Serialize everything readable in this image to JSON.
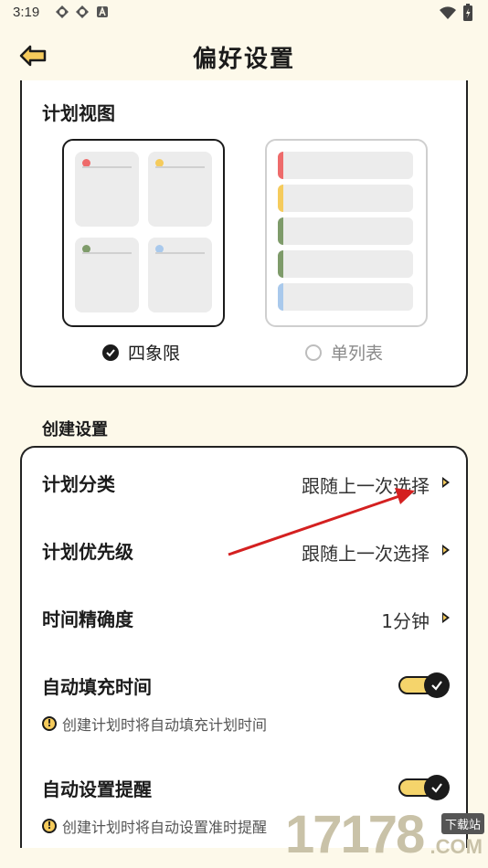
{
  "status": {
    "time": "3:19"
  },
  "header": {
    "title": "偏好设置"
  },
  "plan_view": {
    "title": "计划视图",
    "options": [
      {
        "label": "四象限",
        "selected": true
      },
      {
        "label": "单列表",
        "selected": false
      }
    ],
    "quad_colors": [
      "#ee6b6b",
      "#f5cb5c",
      "#7e9b6a",
      "#a9c9ec"
    ],
    "list_colors": [
      "#ee6b6b",
      "#f5cb5c",
      "#7e9b6a",
      "#7e9b6a",
      "#a9c9ec"
    ]
  },
  "create_settings": {
    "title": "创建设置",
    "rows": [
      {
        "label": "计划分类",
        "value": "跟随上一次选择"
      },
      {
        "label": "计划优先级",
        "value": "跟随上一次选择"
      },
      {
        "label": "时间精确度",
        "value": "1分钟"
      }
    ],
    "toggles": [
      {
        "label": "自动填充时间",
        "hint": "创建计划时将自动填充计划时间",
        "on": true
      },
      {
        "label": "自动设置提醒",
        "hint": "创建计划时将自动设置准时提醒",
        "on": true
      }
    ]
  },
  "watermark": {
    "number": "17178",
    "tag": "下载站",
    "domain": ".COM"
  },
  "colors": {
    "accent": "#f5cb5c",
    "background": "#fdf9ea",
    "annotation_arrow": "#d42020"
  }
}
